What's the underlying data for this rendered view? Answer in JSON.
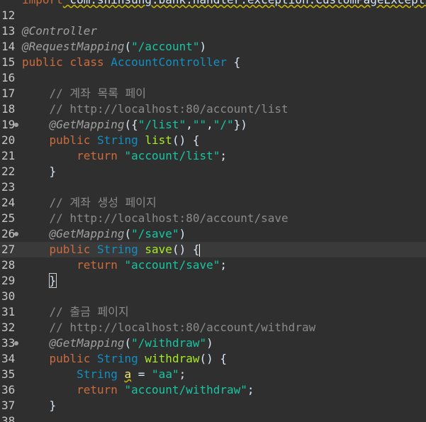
{
  "editor": {
    "colors": {
      "background": "#2f2f2f",
      "current_line": "#3a3a3a",
      "keyword": "#cc6c3c",
      "type": "#1290c3",
      "string": "#17c6a3",
      "method": "#a7ec21",
      "comment": "#8a8a8a",
      "annotation": "#a0a0a0",
      "line_number": "#c8c8c8"
    },
    "lines": [
      {
        "num": "",
        "tokens": [
          [
            "import",
            "t-kw"
          ],
          [
            " com.shinsung.bank.handler.exception.CustomPageException;",
            "t-import"
          ]
        ]
      },
      {
        "num": "12",
        "tokens": []
      },
      {
        "num": "13",
        "tokens": [
          [
            "@Controller",
            "t-anno"
          ]
        ]
      },
      {
        "num": "14",
        "tokens": [
          [
            "@RequestMapping",
            "t-anno"
          ],
          [
            "(",
            "t-plain"
          ],
          [
            "\"/account\"",
            "t-str"
          ],
          [
            ")",
            "t-plain"
          ]
        ]
      },
      {
        "num": "15",
        "tokens": [
          [
            "public",
            "t-kw"
          ],
          [
            " ",
            "t-plain"
          ],
          [
            "class",
            "t-kw"
          ],
          [
            " ",
            "t-plain"
          ],
          [
            "AccountController",
            "t-type"
          ],
          [
            " {",
            "t-plain"
          ]
        ]
      },
      {
        "num": "16",
        "tokens": []
      },
      {
        "num": "17",
        "tokens": [
          [
            "    // 계좌 목록 페이",
            "t-cmt"
          ]
        ]
      },
      {
        "num": "18",
        "tokens": [
          [
            "    // http://localhost:80/account/list",
            "t-cmt"
          ]
        ]
      },
      {
        "num": "19",
        "fold": true,
        "tokens": [
          [
            "    ",
            "t-plain"
          ],
          [
            "@GetMapping",
            "t-anno"
          ],
          [
            "({",
            "t-plain"
          ],
          [
            "\"/list\"",
            "t-str"
          ],
          [
            ",",
            "t-plain"
          ],
          [
            "\"\"",
            "t-str"
          ],
          [
            ",",
            "t-plain"
          ],
          [
            "\"/\"",
            "t-str"
          ],
          [
            "})",
            "t-plain"
          ]
        ]
      },
      {
        "num": "20",
        "tokens": [
          [
            "    ",
            "t-plain"
          ],
          [
            "public",
            "t-kw"
          ],
          [
            " ",
            "t-plain"
          ],
          [
            "String",
            "t-type"
          ],
          [
            " ",
            "t-plain"
          ],
          [
            "list",
            "t-meth"
          ],
          [
            "() {",
            "t-plain"
          ]
        ]
      },
      {
        "num": "21",
        "tokens": [
          [
            "        ",
            "t-plain"
          ],
          [
            "return",
            "t-kw"
          ],
          [
            " ",
            "t-plain"
          ],
          [
            "\"account/list\"",
            "t-str"
          ],
          [
            ";",
            "t-plain"
          ]
        ]
      },
      {
        "num": "22",
        "tokens": [
          [
            "    }",
            "t-plain"
          ]
        ]
      },
      {
        "num": "23",
        "tokens": []
      },
      {
        "num": "24",
        "tokens": [
          [
            "    // 계좌 생성 페이지",
            "t-cmt"
          ]
        ]
      },
      {
        "num": "25",
        "tokens": [
          [
            "    // http://localhost:80/account/save",
            "t-cmt"
          ]
        ]
      },
      {
        "num": "26",
        "fold": true,
        "tokens": [
          [
            "    ",
            "t-plain"
          ],
          [
            "@GetMapping",
            "t-anno"
          ],
          [
            "(",
            "t-plain"
          ],
          [
            "\"/save\"",
            "t-str"
          ],
          [
            ")",
            "t-plain"
          ]
        ]
      },
      {
        "num": "27",
        "current": true,
        "tokens": [
          [
            "    ",
            "t-plain"
          ],
          [
            "public",
            "t-kw"
          ],
          [
            " ",
            "t-plain"
          ],
          [
            "String",
            "t-type"
          ],
          [
            " ",
            "t-plain"
          ],
          [
            "save",
            "t-meth"
          ],
          [
            "() {",
            "t-plain"
          ],
          [
            "",
            "caret"
          ]
        ]
      },
      {
        "num": "28",
        "tokens": [
          [
            "        ",
            "t-plain"
          ],
          [
            "return",
            "t-kw"
          ],
          [
            " ",
            "t-plain"
          ],
          [
            "\"account/save\"",
            "t-str"
          ],
          [
            ";",
            "t-plain"
          ]
        ]
      },
      {
        "num": "29",
        "tokens": [
          [
            "    ",
            "t-plain"
          ],
          [
            "}",
            "brace"
          ]
        ]
      },
      {
        "num": "30",
        "tokens": []
      },
      {
        "num": "31",
        "tokens": [
          [
            "    // 출금 페이지",
            "t-cmt"
          ]
        ]
      },
      {
        "num": "32",
        "tokens": [
          [
            "    // http://localhost:80/account/withdraw",
            "t-cmt"
          ]
        ]
      },
      {
        "num": "33",
        "fold": true,
        "tokens": [
          [
            "    ",
            "t-plain"
          ],
          [
            "@GetMapping",
            "t-anno"
          ],
          [
            "(",
            "t-plain"
          ],
          [
            "\"/withdraw\"",
            "t-str"
          ],
          [
            ")",
            "t-plain"
          ]
        ]
      },
      {
        "num": "34",
        "tokens": [
          [
            "    ",
            "t-plain"
          ],
          [
            "public",
            "t-kw"
          ],
          [
            " ",
            "t-plain"
          ],
          [
            "String",
            "t-type"
          ],
          [
            " ",
            "t-plain"
          ],
          [
            "withdraw",
            "t-meth"
          ],
          [
            "() {",
            "t-plain"
          ]
        ]
      },
      {
        "num": "35",
        "tokens": [
          [
            "        ",
            "t-plain"
          ],
          [
            "String",
            "t-type"
          ],
          [
            " ",
            "t-plain"
          ],
          [
            "a",
            "t-var"
          ],
          [
            " = ",
            "t-plain"
          ],
          [
            "\"aa\"",
            "t-str"
          ],
          [
            ";",
            "t-plain"
          ]
        ]
      },
      {
        "num": "36",
        "tokens": [
          [
            "        ",
            "t-plain"
          ],
          [
            "return",
            "t-kw"
          ],
          [
            " ",
            "t-plain"
          ],
          [
            "\"account/withdraw\"",
            "t-str"
          ],
          [
            ";",
            "t-plain"
          ]
        ]
      },
      {
        "num": "37",
        "tokens": [
          [
            "    }",
            "t-plain"
          ]
        ]
      },
      {
        "num": "38",
        "tokens": []
      }
    ]
  }
}
